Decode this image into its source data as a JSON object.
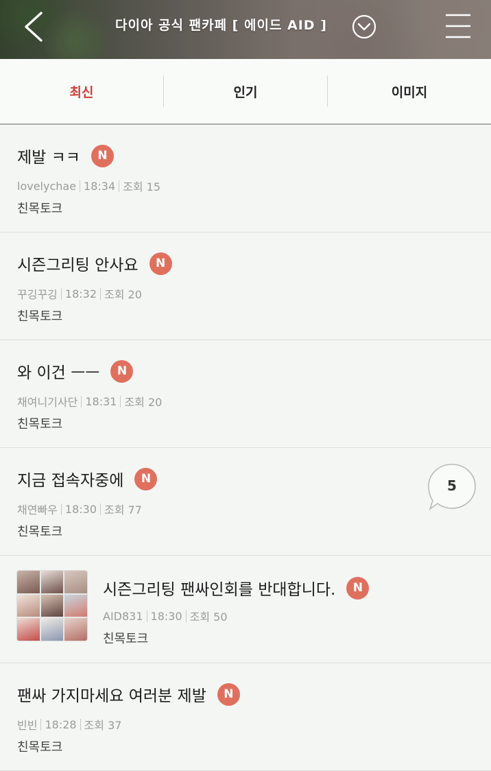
{
  "header": {
    "title": "다이아 공식 팬카페 [ 에이드 AID ]"
  },
  "tabs": [
    {
      "label": "최신",
      "active": true
    },
    {
      "label": "인기",
      "active": false
    },
    {
      "label": "이미지",
      "active": false
    }
  ],
  "badge_label": "N",
  "colors": {
    "accent": "#d23c36",
    "badge": "#e0705e"
  },
  "posts": [
    {
      "title": "제발 ㅋㅋ",
      "author": "lovelychae",
      "time": "18:34",
      "views": "조회 15",
      "board": "친목토크"
    },
    {
      "title": "시즌그리팅 안사요",
      "author": "꾸깅꾸깅",
      "time": "18:32",
      "views": "조회 20",
      "board": "친목토크"
    },
    {
      "title": "와 이건 ㅡㅡ",
      "author": "채여니기사단",
      "time": "18:31",
      "views": "조회 20",
      "board": "친목토크"
    },
    {
      "title": "지금 접속자중에",
      "author": "채연빠우",
      "time": "18:30",
      "views": "조회 77",
      "board": "친목토크",
      "comments": "5"
    },
    {
      "title": "시즌그리팅 팬싸인회를 반대합니다.",
      "author": "AID831",
      "time": "18:30",
      "views": "조회 50",
      "board": "친목토크",
      "thumbnail": true
    },
    {
      "title": "팬싸 가지마세요 여러분 제발",
      "author": "빈빈",
      "time": "18:28",
      "views": "조회 37",
      "board": "친목토크"
    }
  ]
}
